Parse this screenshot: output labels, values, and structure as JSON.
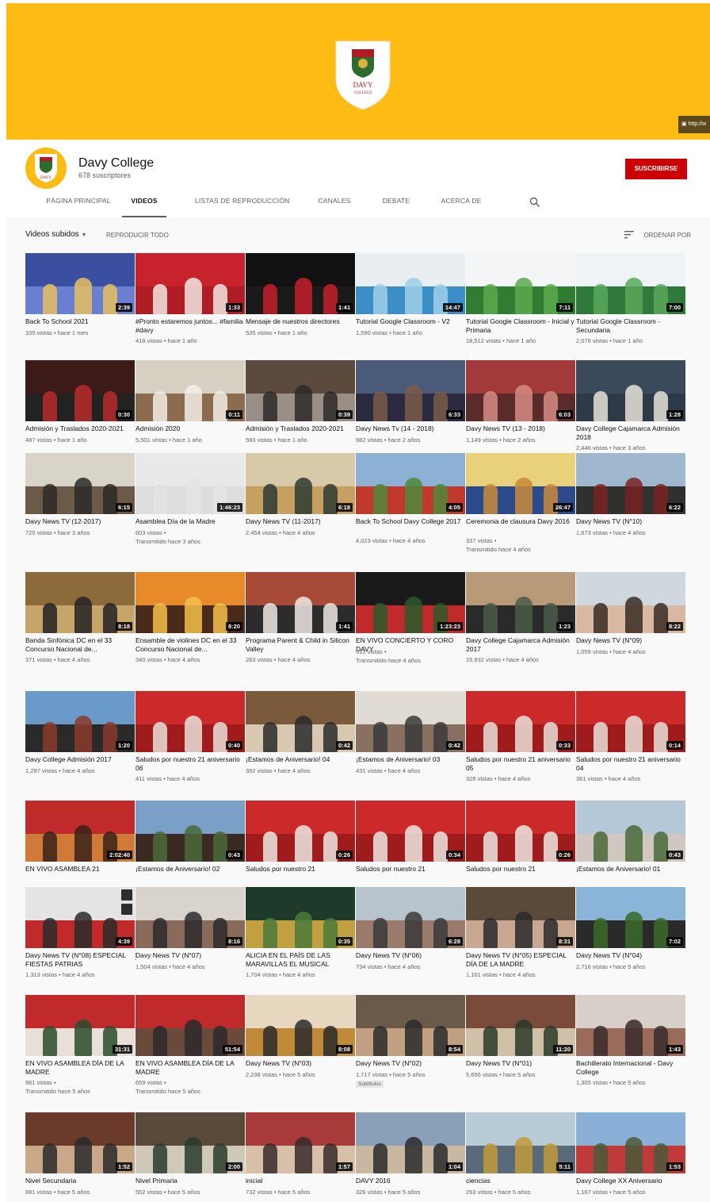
{
  "banner": {
    "link_text": "http://w"
  },
  "channel": {
    "name": "Davy College",
    "subscribers": "678 suscriptores",
    "subscribe_label": "SUSCRIBIRSE",
    "crest_text": "DAVY COLLEGE",
    "crest_initials": "DC",
    "brand_color": "#fdbb13",
    "accent_color": "#cc0000"
  },
  "tabs": [
    {
      "label": "PÁGINA PRINCIPAL"
    },
    {
      "label": "VIDEOS"
    },
    {
      "label": "LISTAS DE REPRODUCCIÓN"
    },
    {
      "label": "CANALES"
    },
    {
      "label": "DEBATE"
    },
    {
      "label": "ACERCA DE"
    }
  ],
  "filters": {
    "uploaded_label": "Videos subidos",
    "play_all_label": "REPRODUCIR TODO",
    "sort_label": "ORDENAR POR"
  },
  "rows": [
    {
      "videos": [
        {
          "title": "Back To School 2021",
          "meta1": "105 vistas • hace 1 mes",
          "meta2": "",
          "duration": "2:39",
          "colors": [
            "#3a4fa0",
            "#e8c060",
            "#6a7fd0"
          ]
        },
        {
          "title": "#Pronto estaremos juntos... #familia #davy",
          "meta1": "418 vistas • hace 1 año",
          "meta2": "",
          "duration": "1:33",
          "colors": [
            "#c8232c",
            "#f2e6e0",
            "#b01c24"
          ]
        },
        {
          "title": "Mensaje de nuestros directores",
          "meta1": "535 vistas • hace 1 año",
          "meta2": "",
          "duration": "1:41",
          "colors": [
            "#111111",
            "#c4202a",
            "#1a1a1a"
          ]
        },
        {
          "title": "Tutorial Google Classroom - V2",
          "meta1": "1,590 vistas • hace 1 año",
          "meta2": "",
          "duration": "14:47",
          "colors": [
            "#e9eef2",
            "#9fd0e8",
            "#3c8fc6"
          ]
        },
        {
          "title": "Tutorial Google Classroom - Inicial y Primaria",
          "meta1": "18,512 vistas • hace 1 año",
          "meta2": "",
          "duration": "7:11",
          "colors": [
            "#f3f5f7",
            "#5aa94e",
            "#2e7d32"
          ]
        },
        {
          "title": "Tutorial Google Classroom - Secundaria",
          "meta1": "2,076 vistas • hace 1 año",
          "meta2": "",
          "duration": "7:00",
          "colors": [
            "#eef3f5",
            "#58a85a",
            "#2f7a3a"
          ]
        }
      ]
    },
    {
      "videos": [
        {
          "title": "Admisión y Traslados 2020-2021",
          "meta1": "487 vistas • hace 1 año",
          "meta2": "",
          "duration": "0:30",
          "colors": [
            "#3b1a18",
            "#b82a2a",
            "#222222"
          ]
        },
        {
          "title": "Admisión 2020",
          "meta1": "5,501 vistas • hace 1 año",
          "meta2": "",
          "duration": "0:11",
          "colors": [
            "#d7cfc2",
            "#f2ede6",
            "#8c6b4e"
          ]
        },
        {
          "title": "Admisión y Traslados 2020-2021",
          "meta1": "593 vistas • hace 1 año",
          "meta2": "",
          "duration": "0:39",
          "colors": [
            "#5c4a3c",
            "#2e2a28",
            "#9a8f86"
          ]
        },
        {
          "title": "Davy News Tv (14 - 2018)",
          "meta1": "982 vistas • hace 2 años",
          "meta2": "",
          "duration": "6:33",
          "colors": [
            "#4a5b7a",
            "#7a5c48",
            "#2c2a40"
          ]
        },
        {
          "title": "Davy News TV (13 - 2018)",
          "meta1": "1,149 vistas • hace 2 años",
          "meta2": "",
          "duration": "6:03",
          "colors": [
            "#a33a3a",
            "#d68c84",
            "#5b2a2a"
          ]
        },
        {
          "title": "Davy College Cajamarca Admisión 2018",
          "meta1": "2,446 vistas • hace 3 años",
          "meta2": "",
          "duration": "1:28",
          "colors": [
            "#3a4a5a",
            "#e8e2d8",
            "#2e3a48"
          ]
        }
      ]
    },
    {
      "videos": [
        {
          "title": "Davy News TV (12-2017)",
          "meta1": "725 vistas • hace 3 años",
          "meta2": "",
          "duration": "6:15",
          "colors": [
            "#d9d4c8",
            "#2c2a28",
            "#6b5a48"
          ]
        },
        {
          "title": "Asamblea Día de la Madre",
          "meta1": "603 vistas •",
          "meta2": "Transmitido hace 3 años",
          "duration": "1:46:23",
          "colors": [
            "#e9e9e9",
            "#e4e4e4",
            "#dddddd"
          ]
        },
        {
          "title": "Davy News TV (11-2017)",
          "meta1": "2,454 vistas • hace 4 años",
          "meta2": "",
          "duration": "6:18",
          "colors": [
            "#d8c9a8",
            "#2e3a30",
            "#c5a060"
          ]
        },
        {
          "title": "Back To School Davy College 2017",
          "meta1": "4,023 vistas • hace 4 años",
          "meta2": "",
          "duration": "4:05",
          "colors": [
            "#8cb1d4",
            "#4e8a3a",
            "#c0392b"
          ]
        },
        {
          "title": "Ceremonia de clausura Davy 2016",
          "meta1": "337 vistas •",
          "meta2": "Transmitido hace 4 años",
          "duration": "26:47",
          "colors": [
            "#e9d07a",
            "#c98a3a",
            "#2c4a8a"
          ]
        },
        {
          "title": "Davy News TV (N°10)",
          "meta1": "1,673 vistas • hace 4 años",
          "meta2": "",
          "duration": "6:22",
          "colors": [
            "#9fb8d0",
            "#7a2222",
            "#30302e"
          ]
        }
      ]
    },
    {
      "videos": [
        {
          "title": "Banda Sinfónica DC en el 33 Concurso Nacional de...",
          "meta1": "371 vistas • hace 4 años",
          "meta2": "",
          "duration": "8:18",
          "colors": [
            "#8c6a3a",
            "#222222",
            "#c6a46a"
          ]
        },
        {
          "title": "Ensamble de violines DC en el 33 Concurso Nacional de...",
          "meta1": "340 vistas • hace 4 años",
          "meta2": "",
          "duration": "8:20",
          "colors": [
            "#e88a2a",
            "#f4c04a",
            "#4a2a1a"
          ]
        },
        {
          "title": "Programa Parent & Child in Silicon Valley",
          "meta1": "263 vistas • hace 4 años",
          "meta2": "",
          "duration": "1:41",
          "colors": [
            "#a84a38",
            "#ede8e2",
            "#2c2c2c"
          ]
        },
        {
          "title": "EN VIVO CONCIERTO Y CORO DAVY",
          "meta1": "512 vistas •",
          "meta2": "Transmitido hace 4 años",
          "duration": "1:23:23",
          "colors": [
            "#1a1a1a",
            "#2a5a2a",
            "#c02a2a"
          ]
        },
        {
          "title": "Davy College Cajamarca Admisión 2017",
          "meta1": "15,932 vistas • hace 4 años",
          "meta2": "",
          "duration": "1:23",
          "colors": [
            "#b89a78",
            "#4a5a4a",
            "#2a2a2a"
          ]
        },
        {
          "title": "Davy News TV (N°09)",
          "meta1": "1,059 vistas • hace 4 años",
          "meta2": "",
          "duration": "8:22",
          "colors": [
            "#cfd8de",
            "#3a2a22",
            "#d8b8a0"
          ]
        }
      ]
    },
    {
      "videos": [
        {
          "title": "Davy College Admisión 2017",
          "meta1": "1,297 vistas • hace 4 años",
          "meta2": "",
          "duration": "1:20",
          "colors": [
            "#6a9ac8",
            "#8a3a2a",
            "#2a2a2a"
          ]
        },
        {
          "title": "Saludos por nuestro 21 aniversario 06",
          "meta1": "411 vistas • hace 4 años",
          "meta2": "",
          "duration": "0:40",
          "colors": [
            "#cc2a2a",
            "#e8e0d8",
            "#a01c1c"
          ]
        },
        {
          "title": "¡Estamos de Aniversario! 04",
          "meta1": "392 vistas • hace 4 años",
          "meta2": "",
          "duration": "0:42",
          "colors": [
            "#7a5a3a",
            "#2a2a2a",
            "#d8c8b0"
          ]
        },
        {
          "title": "¡Estamos de Aniversario! 03",
          "meta1": "431 vistas • hace 4 años",
          "meta2": "",
          "duration": "0:42",
          "colors": [
            "#e0dcd4",
            "#3a3a3a",
            "#8a7060"
          ]
        },
        {
          "title": "Saludos por nuestro 21 aniversario 05",
          "meta1": "328 vistas • hace 4 años",
          "meta2": "",
          "duration": "0:33",
          "colors": [
            "#cc2a2a",
            "#e8e0d8",
            "#a01c1c"
          ]
        },
        {
          "title": "Saludos por nuestro 21 aniversario 04",
          "meta1": "361 vistas • hace 4 años",
          "meta2": "",
          "duration": "0:14",
          "colors": [
            "#cc2a2a",
            "#e8e0d8",
            "#a01c1c"
          ]
        }
      ]
    },
    {
      "videos": [
        {
          "title": "EN VIVO ASAMBLEA 21",
          "meta1": "",
          "meta2": "",
          "duration": "2:02:40",
          "colors": [
            "#c02a2a",
            "#3a2218",
            "#d07a3a"
          ]
        },
        {
          "title": "¡Estamos de Aniversario! 02",
          "meta1": "",
          "meta2": "",
          "duration": "0:43",
          "colors": [
            "#7aa0c8",
            "#4a6a3a",
            "#3a2a22"
          ]
        },
        {
          "title": "Saludos por nuestro 21",
          "meta1": "",
          "meta2": "",
          "duration": "0:26",
          "colors": [
            "#cc2a2a",
            "#ece6e0",
            "#a01c1c"
          ]
        },
        {
          "title": "Saludos por nuestro 21",
          "meta1": "",
          "meta2": "",
          "duration": "0:34",
          "colors": [
            "#cc2a2a",
            "#ece6e0",
            "#a01c1c"
          ]
        },
        {
          "title": "Saludos por nuestro 21",
          "meta1": "",
          "meta2": "",
          "duration": "0:26",
          "colors": [
            "#cc2a2a",
            "#ece6e0",
            "#a01c1c"
          ]
        },
        {
          "title": "¡Estamos de Aniversario! 01",
          "meta1": "",
          "meta2": "",
          "duration": "0:43",
          "colors": [
            "#b4c8d8",
            "#4a6a3a",
            "#d0c8c0"
          ]
        }
      ]
    },
    {
      "videos": [
        {
          "title": "Davy News TV (N°08) ESPECIAL FIESTAS PATRIAS",
          "meta1": "1,313 vistas • hace 4 años",
          "meta2": "",
          "duration": "4:39",
          "colors": [
            "#e4e4e4",
            "#2a2a2a",
            "#c02a2a"
          ]
        },
        {
          "title": "Davy News TV (N°07)",
          "meta1": "1,504 vistas • hace 4 años",
          "meta2": "",
          "duration": "8:16",
          "colors": [
            "#d8d4cc",
            "#2a2a2a",
            "#8a6a5a"
          ]
        },
        {
          "title": "ALICIA EN EL PAÍS DE LAS MARAVILLAS EL MUSICAL",
          "meta1": "1,704 vistas • hace 4 años",
          "meta2": "",
          "duration": "0:35",
          "colors": [
            "#1e3a2a",
            "#4a7a3a",
            "#c0a040"
          ]
        },
        {
          "title": "Davy News TV (N°06)",
          "meta1": "734 vistas • hace 4 años",
          "meta2": "",
          "duration": "6:28",
          "colors": [
            "#b8c4cc",
            "#3a3a3a",
            "#9a7a6a"
          ]
        },
        {
          "title": "Davy News TV (N°05) ESPECIAL DÍA DE LA MADRE",
          "meta1": "1,161 vistas • hace 4 años",
          "meta2": "",
          "duration": "8:31",
          "colors": [
            "#5a4a3a",
            "#2a2a2a",
            "#c8a890"
          ]
        },
        {
          "title": "Davy News TV (N°04)",
          "meta1": "2,716 vistas • hace 5 años",
          "meta2": "",
          "duration": "7:02",
          "colors": [
            "#8ab4d8",
            "#3a6a2a",
            "#2a2a2a"
          ]
        }
      ]
    },
    {
      "videos": [
        {
          "title": "EN VIVO ASAMBLEA DÍA DE LA MADRE",
          "meta1": "961 vistas •",
          "meta2": "Transmitido hace 5 años",
          "duration": "31:31",
          "colors": [
            "#c02a2a",
            "#2a4a2a",
            "#e8e0d8"
          ]
        },
        {
          "title": "EN VIVO ASAMBLEA DÍA DE LA MADRE",
          "meta1": "659 vistas •",
          "meta2": "Transmitido hace 5 años",
          "duration": "51:54",
          "colors": [
            "#c02a2a",
            "#2a2a2a",
            "#6a4a3a"
          ]
        },
        {
          "title": "Davy News TV (N°03)",
          "meta1": "2,238 vistas • hace 5 años",
          "meta2": "",
          "duration": "8:08",
          "colors": [
            "#e8d8c0",
            "#2a2a2a",
            "#c08a3a"
          ]
        },
        {
          "title": "Davy News TV (N°02)",
          "meta1": "1,717 vistas • hace 5 años",
          "meta2": "",
          "badge": "Subtítulos",
          "duration": "8:54",
          "colors": [
            "#6a5a4a",
            "#2a2a2a",
            "#c0a080"
          ]
        },
        {
          "title": "Davy News TV (N°01)",
          "meta1": "5,696 vistas • hace 5 años",
          "meta2": "",
          "duration": "11:20",
          "colors": [
            "#7a4a3a",
            "#2a3a2a",
            "#d0c0a8"
          ]
        },
        {
          "title": "Bachillerato Internacional - Davy College",
          "meta1": "1,305 vistas • hace 5 años",
          "meta2": "",
          "duration": "1:43",
          "colors": [
            "#d8d0c8",
            "#3a2a2a",
            "#9a6a5a"
          ]
        }
      ]
    },
    {
      "videos": [
        {
          "title": "Nivel Secundaria",
          "meta1": "881 vistas • hace 5 años",
          "meta2": "",
          "duration": "1:52",
          "colors": [
            "#6a3a2a",
            "#2a2a2a",
            "#c8a888"
          ]
        },
        {
          "title": "Nivel Primaria",
          "meta1": "552 vistas • hace 5 años",
          "meta2": "",
          "duration": "2:00",
          "colors": [
            "#5a4a3a",
            "#2a3a2a",
            "#d0c8b8"
          ]
        },
        {
          "title": "inicial",
          "meta1": "732 vistas • hace 5 años",
          "meta2": "",
          "duration": "1:57",
          "colors": [
            "#a83a3a",
            "#3a2a2a",
            "#d8c0a8"
          ]
        },
        {
          "title": "DAVY 2016",
          "meta1": "326 vistas • hace 5 años",
          "meta2": "",
          "duration": "1:04",
          "colors": [
            "#8aa0b8",
            "#2a2a2a",
            "#c8b8a0"
          ]
        },
        {
          "title": "ciencias",
          "meta1": "293 vistas • hace 5 años",
          "meta2": "",
          "duration": "5:11",
          "colors": [
            "#b8ccd8",
            "#c09a3a",
            "#5a6a7a"
          ]
        },
        {
          "title": "Davy College XX Aniversario",
          "meta1": "1,167 vistas • hace 5 años",
          "meta2": "",
          "duration": "1:53",
          "colors": [
            "#8ab0d8",
            "#4a5a3a",
            "#c03a3a"
          ]
        }
      ]
    }
  ]
}
